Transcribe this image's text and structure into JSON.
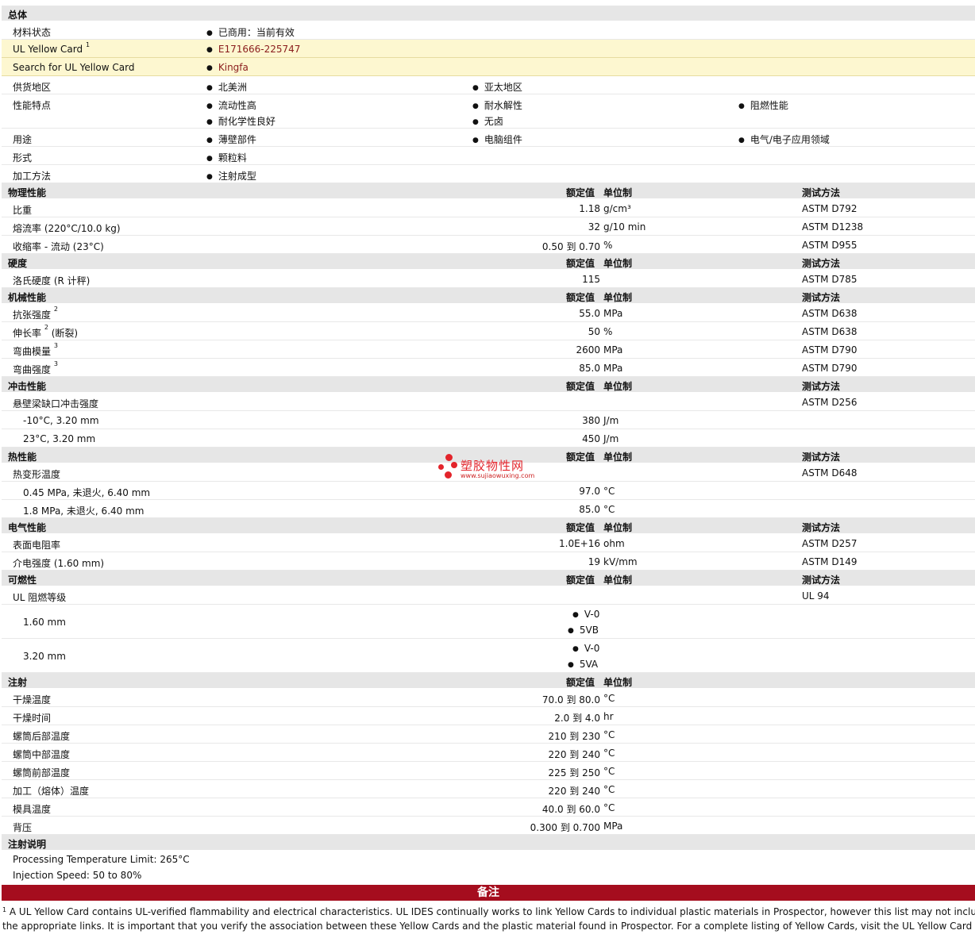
{
  "general": {
    "title": "总体",
    "material_status_label": "材料状态",
    "material_status_value": "已商用：当前有效",
    "yellow_card_label": "UL Yellow Card",
    "yellow_card_sup": "1",
    "yellow_card_value": "E171666-225747",
    "search_label": "Search for UL Yellow Card",
    "search_value": "Kingfa",
    "availability_label": "供货地区",
    "availability": [
      "北美洲",
      "亚太地区"
    ],
    "features_label": "性能特点",
    "features": [
      "流动性高",
      "耐水解性",
      "阻燃性能",
      "耐化学性良好",
      "无卤"
    ],
    "uses_label": "用途",
    "uses": [
      "薄壁部件",
      "电脑组件",
      "电气/电子应用领域"
    ],
    "form_label": "形式",
    "form": "颗粒料",
    "processing_label": "加工方法",
    "processing": "注射成型"
  },
  "col_headers": {
    "nominal": "额定值",
    "unit": "单位制",
    "method": "测试方法"
  },
  "physical": {
    "title": "物理性能",
    "rows": [
      {
        "label": "比重",
        "value": "1.18",
        "unit": "g/cm³",
        "method": "ASTM D792"
      },
      {
        "label": "熔流率  (220°C/10.0 kg)",
        "value": "32",
        "unit": "g/10 min",
        "method": "ASTM D1238"
      },
      {
        "label": "收缩率  - 流动  (23°C)",
        "value": "0.50 到  0.70",
        "unit": "%",
        "method": "ASTM D955"
      }
    ]
  },
  "hardness": {
    "title": "硬度",
    "rows": [
      {
        "label": "洛氏硬度  (R 计秤)",
        "value": "115",
        "unit": "",
        "method": "ASTM D785"
      }
    ]
  },
  "mechanical": {
    "title": "机械性能",
    "rows": [
      {
        "label": "抗张强度",
        "sup": "2",
        "suffix": "",
        "value": "55.0",
        "unit": "MPa",
        "method": "ASTM D638"
      },
      {
        "label": "伸长率",
        "sup": "2",
        "suffix": " (断裂)",
        "value": "50",
        "unit": "%",
        "method": "ASTM D638"
      },
      {
        "label": "弯曲模量",
        "sup": "3",
        "suffix": "",
        "value": "2600",
        "unit": "MPa",
        "method": "ASTM D790"
      },
      {
        "label": "弯曲强度",
        "sup": "3",
        "suffix": "",
        "value": "85.0",
        "unit": "MPa",
        "method": "ASTM D790"
      }
    ]
  },
  "impact": {
    "title": "冲击性能",
    "rows": [
      {
        "label": "悬壁梁缺口冲击强度",
        "value": "",
        "unit": "",
        "method": "ASTM D256"
      },
      {
        "label": "-10°C, 3.20 mm",
        "value": "380",
        "unit": "J/m",
        "method": ""
      },
      {
        "label": "23°C, 3.20 mm",
        "value": "450",
        "unit": "J/m",
        "method": ""
      }
    ]
  },
  "thermal": {
    "title": "热性能",
    "rows": [
      {
        "label": "热变形温度",
        "value": "",
        "unit": "",
        "method": "ASTM D648"
      },
      {
        "label": "0.45 MPa, 未退火, 6.40 mm",
        "value": "97.0",
        "unit": "°C",
        "method": ""
      },
      {
        "label": "1.8 MPa, 未退火, 6.40 mm",
        "value": "85.0",
        "unit": "°C",
        "method": ""
      }
    ]
  },
  "electrical": {
    "title": "电气性能",
    "rows": [
      {
        "label": "表面电阻率",
        "value": "1.0E+16",
        "unit": "ohm",
        "method": "ASTM D257"
      },
      {
        "label": "介电强度  (1.60 mm)",
        "value": "19",
        "unit": "kV/mm",
        "method": "ASTM D149"
      }
    ]
  },
  "flammability": {
    "title": "可燃性",
    "rating_label": "UL 阻燃等级",
    "rating_method": "UL 94",
    "r1_label": "1.60 mm",
    "r1_values": [
      "V-0",
      "5VB"
    ],
    "r2_label": "3.20 mm",
    "r2_values": [
      "V-0",
      "5VA"
    ]
  },
  "injection": {
    "title": "注射",
    "rows": [
      {
        "label": "干燥温度",
        "value": "70.0 到  80.0",
        "unit": "°C"
      },
      {
        "label": "干燥时间",
        "value": "2.0 到  4.0",
        "unit": "hr"
      },
      {
        "label": "螺筒后部温度",
        "value": "210 到  230",
        "unit": "°C"
      },
      {
        "label": "螺筒中部温度",
        "value": "220 到  240",
        "unit": "°C"
      },
      {
        "label": "螺筒前部温度",
        "value": "225 到  250",
        "unit": "°C"
      },
      {
        "label": "加工（熔体）温度",
        "value": "220 到  240",
        "unit": "°C"
      },
      {
        "label": "模具温度",
        "value": "40.0 到  60.0",
        "unit": "°C"
      },
      {
        "label": "背压",
        "value": "0.300 到  0.700",
        "unit": "MPa"
      }
    ]
  },
  "injection_notes": {
    "title": "注射说明",
    "line1": "Processing Temperature Limit: 265°C",
    "line2": "Injection Speed: 50 to 80%"
  },
  "remarks": {
    "title": "备注",
    "footnote_num": "1",
    "footnote_text": " A UL Yellow Card contains UL-verified flammability and electrical characteristics. UL IDES continually works to link Yellow Cards to individual plastic materials in Prospector, however this list may not include al",
    "footnote_text2": "the appropriate links. It is important that you verify the association between these Yellow Cards and the plastic material found in Prospector. For a complete listing of Yellow Cards, visit the UL Yellow Card Search."
  },
  "watermark": {
    "name": "塑胶物性网",
    "url": "www.sujiaowuxing.com"
  }
}
